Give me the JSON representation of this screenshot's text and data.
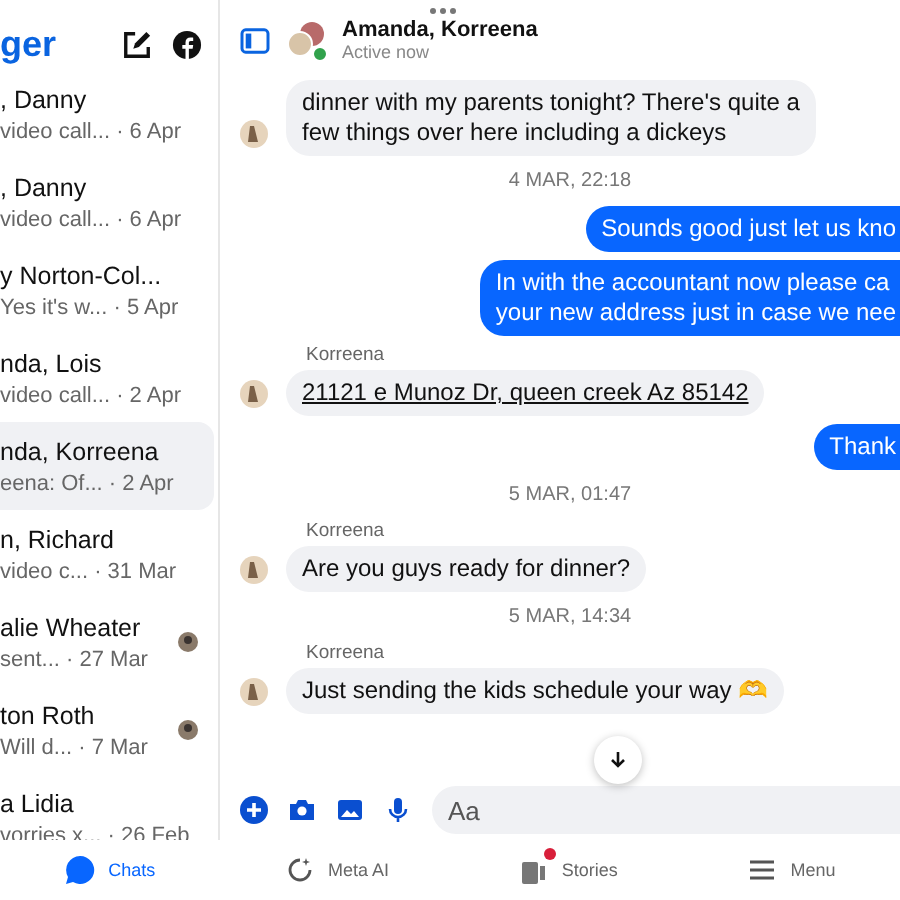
{
  "sidebar": {
    "title": "ger",
    "chats": [
      {
        "name": ", Danny",
        "preview": "video call... · 6 Apr",
        "selected": false,
        "avatar": false
      },
      {
        "name": ", Danny",
        "preview": "video call... · 6 Apr",
        "selected": false,
        "avatar": false
      },
      {
        "name": "y Norton-Col...",
        "preview": "Yes it's w... · 5 Apr",
        "selected": false,
        "avatar": false
      },
      {
        "name": "nda, Lois",
        "preview": "video call... · 2 Apr",
        "selected": false,
        "avatar": false
      },
      {
        "name": "nda, Korreena",
        "preview": "eena: Of...  · 2 Apr",
        "selected": true,
        "avatar": false
      },
      {
        "name": "n, Richard",
        "preview": "video c...  · 31 Mar",
        "selected": false,
        "avatar": false
      },
      {
        "name": "alie Wheater",
        "preview": "sent... · 27 Mar",
        "selected": false,
        "avatar": true
      },
      {
        "name": "ton Roth",
        "preview": "Will d... · 7 Mar",
        "selected": false,
        "avatar": true
      },
      {
        "name": "a Lidia",
        "preview": "vorries x... · 26 Feb",
        "selected": false,
        "avatar": false
      }
    ]
  },
  "conversation": {
    "title": "Amanda, Korreena",
    "status": "Active now",
    "online": true,
    "messages": [
      {
        "kind": "incoming",
        "lines": [
          "dinner with my parents tonight? There's quite a",
          "few things over here including a dickeys"
        ]
      },
      {
        "kind": "timestamp",
        "text": "4 MAR, 22:18"
      },
      {
        "kind": "outgoing",
        "lines": [
          "Sounds good just let us kno"
        ]
      },
      {
        "kind": "outgoing",
        "lines": [
          "In with the accountant now please ca",
          "your new address just in case we nee"
        ]
      },
      {
        "kind": "link",
        "sender": "Korreena",
        "lines": [
          "21121 e Munoz Dr, queen creek Az 85142"
        ]
      },
      {
        "kind": "outgoing",
        "lines": [
          "Thank"
        ]
      },
      {
        "kind": "timestamp",
        "text": "5 MAR, 01:47"
      },
      {
        "kind": "incoming",
        "sender": "Korreena",
        "lines": [
          "Are you guys ready for dinner?"
        ]
      },
      {
        "kind": "timestamp",
        "text": "5 MAR, 14:34"
      },
      {
        "kind": "incoming",
        "sender": "Korreena",
        "lines": [
          "Just sending the kids schedule your way 🫶"
        ]
      }
    ],
    "composer": {
      "placeholder": "Aa"
    }
  },
  "tabs": [
    {
      "label": "Chats",
      "selected": true,
      "kind": "chats",
      "badge": false
    },
    {
      "label": "Meta AI",
      "selected": false,
      "kind": "ai",
      "badge": false
    },
    {
      "label": "Stories",
      "selected": false,
      "kind": "stories",
      "badge": true
    },
    {
      "label": "Menu",
      "selected": false,
      "kind": "menu",
      "badge": false
    }
  ]
}
